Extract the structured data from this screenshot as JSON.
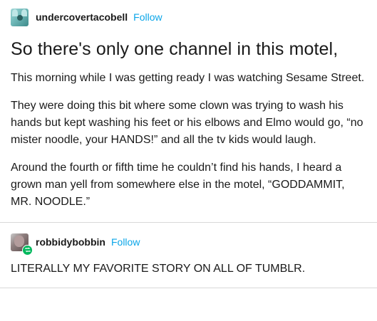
{
  "original_post": {
    "username": "undercovertacobell",
    "follow_label": "Follow",
    "title": "So there's only one channel in this motel,",
    "paragraphs": [
      "This morning while I was getting ready I was watching Sesame Street.",
      "They were doing this bit where some clown was trying to wash his hands but kept washing his feet or his elbows and Elmo would go, “no mister noodle, your HANDS!” and all the tv kids would laugh.",
      "Around the fourth or fifth time he couldn’t find his hands, I heard a grown man yell from somewhere else in the motel, “GODDAMMIT, MR. NOODLE.”"
    ]
  },
  "reblog": {
    "username": "robbidybobbin",
    "follow_label": "Follow",
    "badge_icon": "reblog-icon",
    "text": "LITERALLY MY FAVORITE STORY ON ALL OF TUMBLR."
  },
  "colors": {
    "follow": "#0aa5e8",
    "reblog_badge": "#00b85c",
    "divider": "#d9d9d9"
  }
}
